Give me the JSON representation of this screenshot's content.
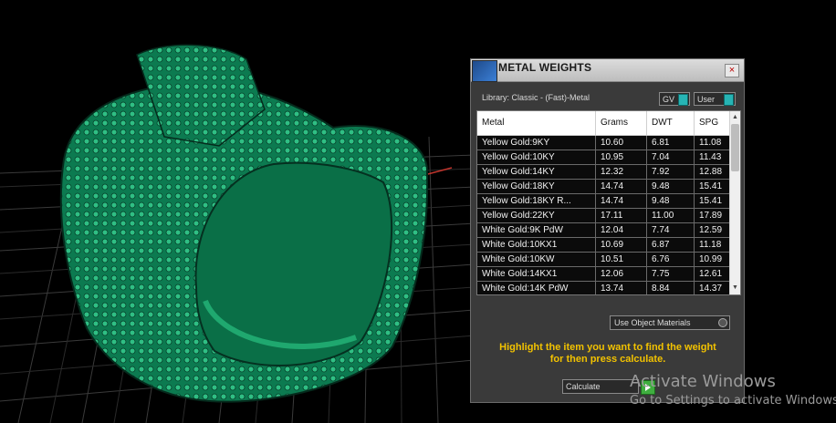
{
  "dialog": {
    "title": "METAL WEIGHTS",
    "close_glyph": "×",
    "library_label": "Library: Classic - (Fast)-Metal",
    "gv_label": "GV",
    "user_label": "User",
    "columns": [
      "Metal",
      "Grams",
      "DWT",
      "SPG"
    ],
    "rows": [
      [
        "Yellow Gold:9KY",
        "10.60",
        "6.81",
        "11.08"
      ],
      [
        "Yellow Gold:10KY",
        "10.95",
        "7.04",
        "11.43"
      ],
      [
        "Yellow Gold:14KY",
        "12.32",
        "7.92",
        "12.88"
      ],
      [
        "Yellow Gold:18KY",
        "14.74",
        "9.48",
        "15.41"
      ],
      [
        "Yellow Gold:18KY R...",
        "14.74",
        "9.48",
        "15.41"
      ],
      [
        "Yellow Gold:22KY",
        "17.11",
        "11.00",
        "17.89"
      ],
      [
        "White Gold:9K PdW",
        "12.04",
        "7.74",
        "12.59"
      ],
      [
        "White Gold:10KX1",
        "10.69",
        "6.87",
        "11.18"
      ],
      [
        "White Gold:10KW",
        "10.51",
        "6.76",
        "10.99"
      ],
      [
        "White Gold:14KX1",
        "12.06",
        "7.75",
        "12.61"
      ],
      [
        "White Gold:14K PdW",
        "13.74",
        "8.84",
        "14.37"
      ]
    ],
    "materials_option": "Use Object Materials",
    "instruction_line1": "Highlight the item you want to find the weight",
    "instruction_line2": "for then press calculate.",
    "calculate_label": "Calculate"
  },
  "watermark": {
    "title": "Activate Windows",
    "subtitle": "Go to Settings to activate Windows."
  },
  "colors": {
    "model_green": "#0f8a5c",
    "instruction_yellow": "#f2c200",
    "toggle_teal": "#27b4b4"
  }
}
